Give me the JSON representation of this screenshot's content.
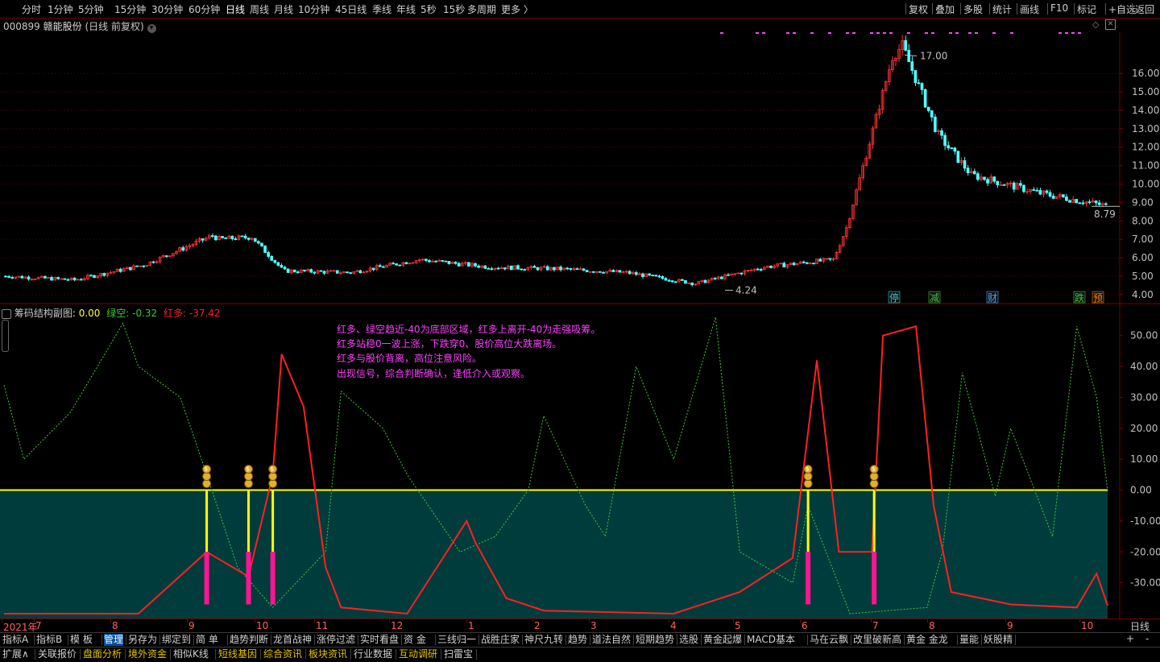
{
  "period_tabs": [
    {
      "label": "分时",
      "active": false
    },
    {
      "label": "1分钟",
      "active": false
    },
    {
      "label": "5分钟",
      "active": false
    },
    {
      "label": "15分钟",
      "active": false
    },
    {
      "label": "30分钟",
      "active": false
    },
    {
      "label": "60分钟",
      "active": false
    },
    {
      "label": "日线",
      "active": true
    },
    {
      "label": "周线",
      "active": false
    },
    {
      "label": "月线",
      "active": false
    },
    {
      "label": "10分钟",
      "active": false
    },
    {
      "label": "45日线",
      "active": false
    },
    {
      "label": "季线",
      "active": false
    },
    {
      "label": "年线",
      "active": false
    },
    {
      "label": "5秒",
      "active": false
    },
    {
      "label": "15秒",
      "active": false
    },
    {
      "label": "多周期",
      "active": false
    },
    {
      "label": "更多 〉",
      "active": false
    }
  ],
  "right_tools": [
    "复权",
    "叠加",
    "多股",
    "统计",
    "画线",
    "F10",
    "标记",
    "+自选",
    "返回"
  ],
  "stock": {
    "code": "000899",
    "name": "赣能股份",
    "period_info": "(日线 前复权)"
  },
  "main_axis": {
    "ticks": [
      "16.00",
      "15.00",
      "14.00",
      "13.00",
      "12.00",
      "11.00",
      "10.00",
      "9.00",
      "8.00",
      "7.00",
      "6.00",
      "5.00",
      "4.00"
    ]
  },
  "price_labels": {
    "high": "17.00",
    "low": "4.24",
    "last": "8.79"
  },
  "event_badges": [
    {
      "text": "停",
      "color": "#3ec8c8"
    },
    {
      "text": "减",
      "color": "#3ec83e"
    },
    {
      "text": "财",
      "color": "#4aa8ff"
    },
    {
      "text": "跌",
      "color": "#3ec83e"
    },
    {
      "text": "预",
      "color": "#ff8000"
    }
  ],
  "indicator": {
    "name": "筹码结构副图",
    "value_label": ": 0.00",
    "green_label": "绿空: ",
    "green_value": "-0.32",
    "red_label": "红多: ",
    "red_value": "-37.42"
  },
  "sub_axis": {
    "ticks": [
      "50.00",
      "40.00",
      "30.00",
      "20.00",
      "10.00",
      "0.00",
      "-10.00",
      "-20.00",
      "-30.00"
    ]
  },
  "notes": [
    "红多、绿空趋近-40为底部区域，红多上离开-40为走强吸筹。",
    "红多站稳0一波上涨，下跌穿0、股价高位大跌离场。",
    "红多与股价背离，高位注意风险。",
    "出现信号，综合判断确认，逢低介入或观察。"
  ],
  "time_axis": {
    "labels": [
      "2021年",
      "7",
      "8",
      "9",
      "10",
      "11",
      "12",
      "1",
      "2",
      "3",
      "4",
      "5",
      "6",
      "7",
      "8",
      "9",
      "10"
    ],
    "period_label": "日线"
  },
  "bottom_tabs_1": [
    "指标A",
    "指标B",
    "模 板",
    "管理",
    "另存为",
    "绑定到",
    "简 单",
    "趋势判断",
    "龙首战神",
    "涨停过滤",
    "实时看盘",
    "资 金",
    "三线归一",
    "战胜庄家",
    "神尺九转",
    "趋势",
    "道法自然",
    "短期趋势",
    "选股",
    "黄金起爆",
    "MACD基本",
    "马在云飘",
    "改里破新高",
    "黄金 金龙",
    "量能",
    "妖股精"
  ],
  "bottom_tabs_1_active": "管理",
  "bottom_tabs_2": [
    "扩展∧",
    "关联报价",
    "盘面分析",
    "境外资金",
    "相似K线",
    "短线基因",
    "综合资讯",
    "板块资讯",
    "行业数据",
    "互动调研",
    "扫雷宝"
  ],
  "colors": {
    "up": "#ff3232",
    "down": "#54ffff",
    "red_line": "#ff2020",
    "green_line": "#3cc83c",
    "zero_line": "#ffff00",
    "fill": "#003c3c",
    "grid": "#7a0000",
    "magenta": "#ff40ff"
  },
  "chart_data": {
    "type": "candlestick+indicator",
    "price_range": [
      3.6,
      17.8
    ],
    "price_high": 17.0,
    "price_low": 4.24,
    "price_last": 8.79,
    "monthly_closes": [
      {
        "x": "2021-06",
        "close": 5.0
      },
      {
        "x": "2021-07",
        "close": 4.8
      },
      {
        "x": "2021-08",
        "close": 5.6
      },
      {
        "x": "2021-09",
        "close": 7.2
      },
      {
        "x": "2021-10",
        "close": 5.3
      },
      {
        "x": "2021-11",
        "close": 5.2
      },
      {
        "x": "2021-12",
        "close": 5.9
      },
      {
        "x": "2022-01",
        "close": 5.5
      },
      {
        "x": "2022-02",
        "close": 5.4
      },
      {
        "x": "2022-03",
        "close": 5.2
      },
      {
        "x": "2022-04",
        "close": 4.6
      },
      {
        "x": "2022-05",
        "close": 5.5
      },
      {
        "x": "2022-06",
        "close": 5.9
      },
      {
        "x": "2022-07",
        "close": 15.0
      },
      {
        "x": "2022-08",
        "close": 10.5
      },
      {
        "x": "2022-09",
        "close": 9.5
      },
      {
        "x": "2022-10",
        "close": 8.79
      }
    ],
    "indicator_range": [
      -40,
      58
    ],
    "red_multi": [
      {
        "x": "2021-06",
        "y": -40
      },
      {
        "x": "2021-08",
        "y": -40
      },
      {
        "x": "2021-09",
        "y": -20
      },
      {
        "x": "2021-09-20",
        "y": -28
      },
      {
        "x": "2021-10-01",
        "y": 5
      },
      {
        "x": "2021-10-05",
        "y": 44
      },
      {
        "x": "2021-10-15",
        "y": 27
      },
      {
        "x": "2021-10-25",
        "y": -25
      },
      {
        "x": "2021-11",
        "y": -38
      },
      {
        "x": "2021-12",
        "y": -40
      },
      {
        "x": "2021-12-28",
        "y": -10
      },
      {
        "x": "2022-01",
        "y": -17
      },
      {
        "x": "2022-01-15",
        "y": -35
      },
      {
        "x": "2022-02",
        "y": -39
      },
      {
        "x": "2022-04",
        "y": -40
      },
      {
        "x": "2022-05",
        "y": -33
      },
      {
        "x": "2022-05-25",
        "y": -22
      },
      {
        "x": "2022-06-05",
        "y": 42
      },
      {
        "x": "2022-06-15",
        "y": -20
      },
      {
        "x": "2022-06-30",
        "y": -20
      },
      {
        "x": "2022-07-05",
        "y": 50
      },
      {
        "x": "2022-07-20",
        "y": 53
      },
      {
        "x": "2022-07-28",
        "y": -5
      },
      {
        "x": "2022-08-05",
        "y": -33
      },
      {
        "x": "2022-09",
        "y": -37
      },
      {
        "x": "2022-10",
        "y": -38
      },
      {
        "x": "2022-10-10",
        "y": -27
      },
      {
        "x": "2022-10-15",
        "y": -37.42
      }
    ],
    "green_short": [
      {
        "x": "2021-06",
        "y": 34
      },
      {
        "x": "2021-06-10",
        "y": 10
      },
      {
        "x": "2021-07",
        "y": 25
      },
      {
        "x": "2021-07-25",
        "y": 54
      },
      {
        "x": "2021-08",
        "y": 40
      },
      {
        "x": "2021-08-20",
        "y": 30
      },
      {
        "x": "2021-09",
        "y": 5
      },
      {
        "x": "2021-09-15",
        "y": -25
      },
      {
        "x": "2021-10",
        "y": -38
      },
      {
        "x": "2021-10-25",
        "y": -20
      },
      {
        "x": "2021-11",
        "y": 32
      },
      {
        "x": "2021-11-20",
        "y": 20
      },
      {
        "x": "2021-12",
        "y": 5
      },
      {
        "x": "2021-12-25",
        "y": -20
      },
      {
        "x": "2022-01-10",
        "y": -15
      },
      {
        "x": "2022-01-25",
        "y": 0
      },
      {
        "x": "2022-02",
        "y": 24
      },
      {
        "x": "2022-02-20",
        "y": -5
      },
      {
        "x": "2022-03",
        "y": -15
      },
      {
        "x": "2022-03-15",
        "y": 40
      },
      {
        "x": "2022-04",
        "y": 10
      },
      {
        "x": "2022-04-20",
        "y": 56
      },
      {
        "x": "2022-05",
        "y": -20
      },
      {
        "x": "2022-05-25",
        "y": -30
      },
      {
        "x": "2022-06",
        "y": -5
      },
      {
        "x": "2022-06-20",
        "y": -40
      },
      {
        "x": "2022-07-25",
        "y": -38
      },
      {
        "x": "2022-08",
        "y": -20
      },
      {
        "x": "2022-08-10",
        "y": 38
      },
      {
        "x": "2022-08-25",
        "y": -2
      },
      {
        "x": "2022-09",
        "y": 20
      },
      {
        "x": "2022-09-20",
        "y": -15
      },
      {
        "x": "2022-10",
        "y": 53
      },
      {
        "x": "2022-10-10",
        "y": 30
      },
      {
        "x": "2022-10-15",
        "y": -0.32
      }
    ],
    "signals": [
      "2021-09",
      "2021-09-20",
      "2021-10",
      "2022-06",
      "2022-07"
    ]
  }
}
